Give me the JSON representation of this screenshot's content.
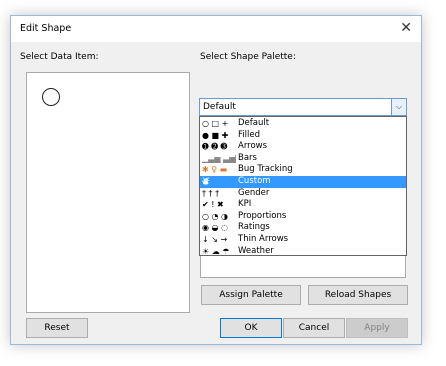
{
  "dialog": {
    "title": "Edit Shape",
    "close_glyph": "✕"
  },
  "left": {
    "label": "Select Data Item:",
    "selected_shape": "open-circle"
  },
  "palette": {
    "label": "Select Shape Palette:",
    "selected": "Default",
    "dropdown_arrow": "⌵",
    "items": [
      {
        "icons": "○ □ +",
        "label": "Default"
      },
      {
        "icons": "● ■ ✚",
        "label": "Filled"
      },
      {
        "icons": "➊ ➋ ➌",
        "label": "Arrows"
      },
      {
        "icons": "▁▃▅ ▃▅▇",
        "label": "Bars"
      },
      {
        "icons": "✱ ♀ ▬",
        "label": "Bug Tracking"
      },
      {
        "icons": "  ⛇",
        "label": "Custom"
      },
      {
        "icons": "† † †",
        "label": "Gender"
      },
      {
        "icons": "✔ ! ✖",
        "label": "KPI"
      },
      {
        "icons": "○ ◔ ◑",
        "label": "Proportions"
      },
      {
        "icons": "◉ ◒ ◌",
        "label": "Ratings"
      },
      {
        "icons": "↓ ↘ →",
        "label": "Thin Arrows"
      },
      {
        "icons": "☀ ☁ ☂",
        "label": "Weather"
      }
    ],
    "highlighted_index": 5
  },
  "buttons": {
    "assign": "Assign Palette",
    "reload": "Reload Shapes",
    "reset": "Reset",
    "ok": "OK",
    "cancel": "Cancel",
    "apply": "Apply"
  },
  "colors": {
    "highlight": "#3399ff",
    "focus_border": "#0078d7"
  }
}
